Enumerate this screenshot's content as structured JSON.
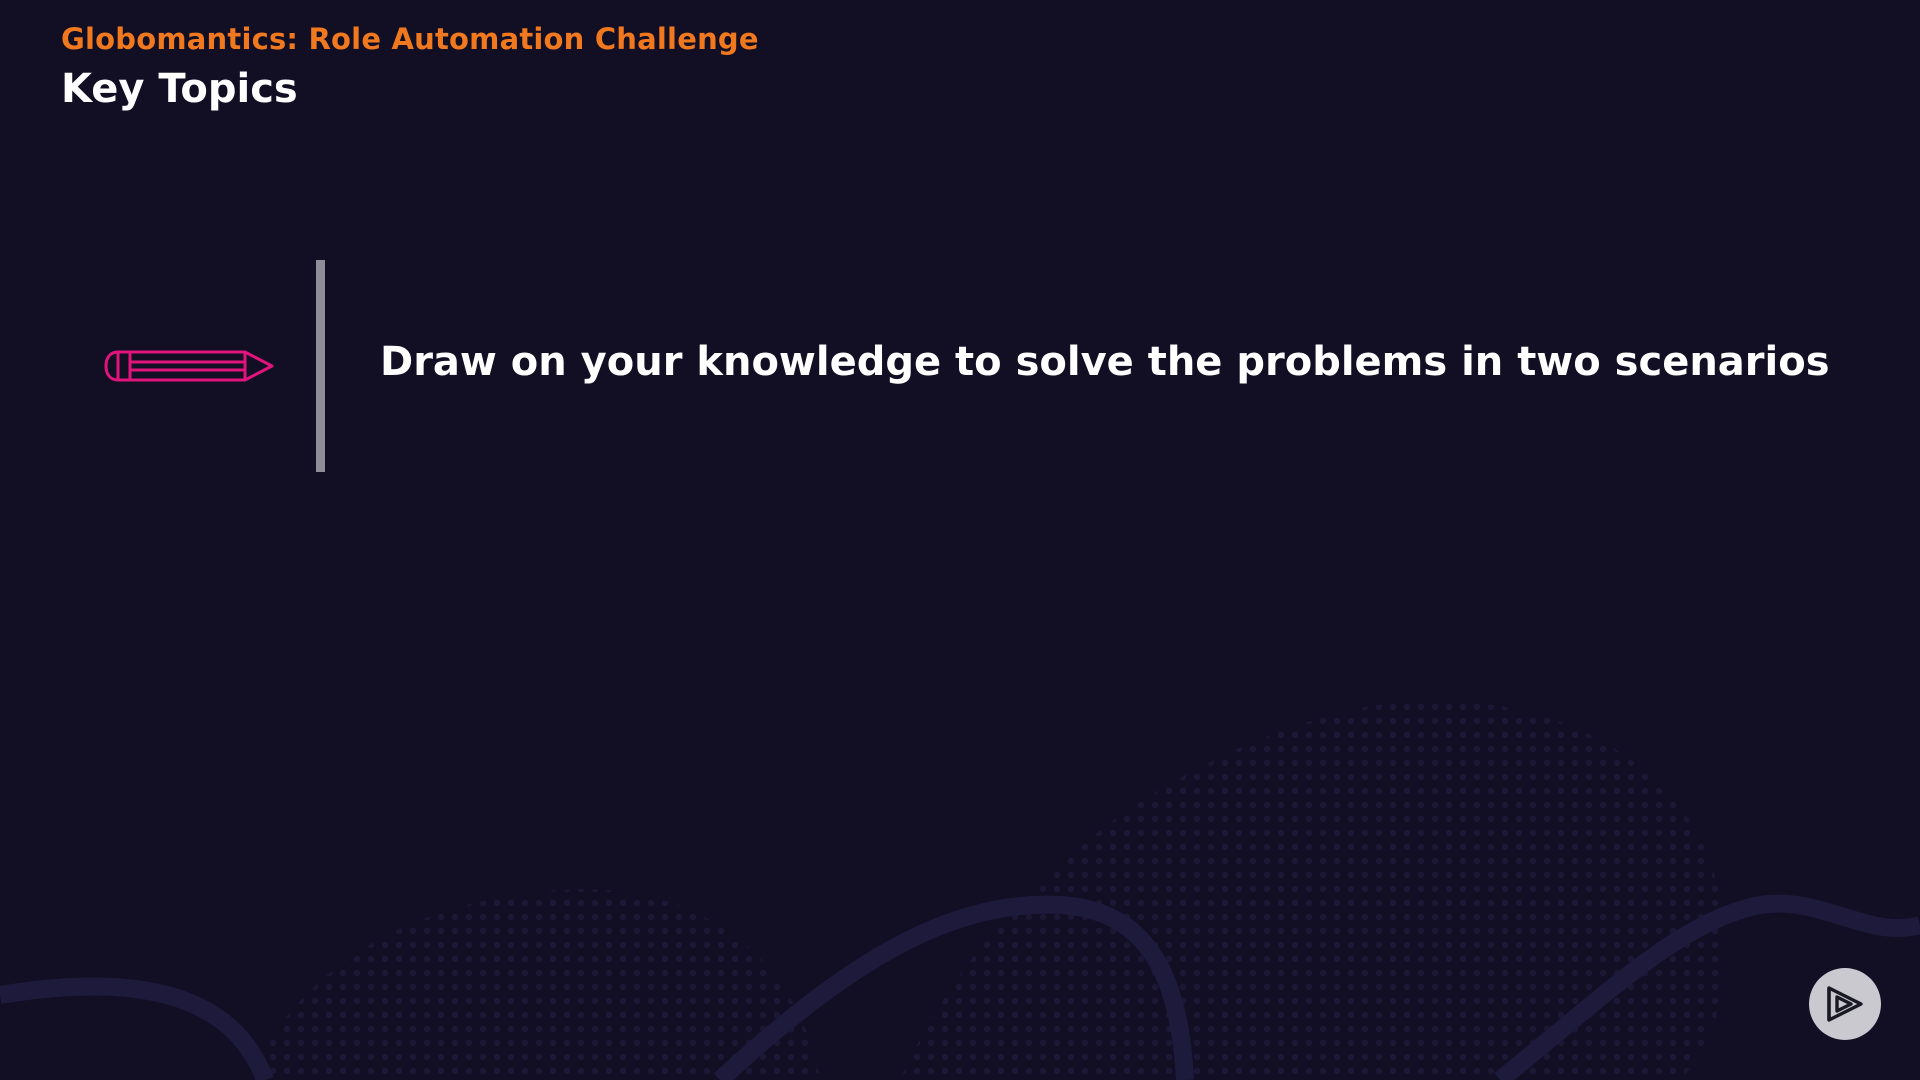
{
  "header": {
    "course_title": "Globomantics: Role Automation Challenge",
    "slide_title": "Key Topics"
  },
  "topics": [
    {
      "icon": "pencil-icon",
      "text": "Draw on your knowledge to solve the problems in two scenarios"
    }
  ],
  "branding": {
    "icon": "play-logo-icon"
  },
  "colors": {
    "background": "#120e23",
    "accent_orange": "#f0781e",
    "accent_magenta": "#e0147a",
    "divider_gray": "#8f8d98"
  }
}
